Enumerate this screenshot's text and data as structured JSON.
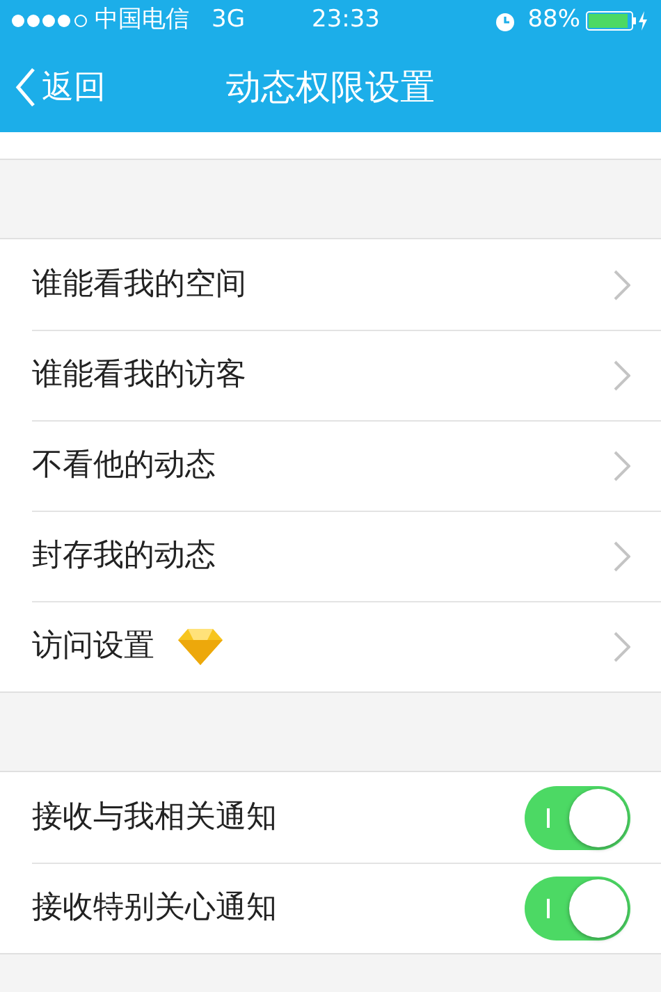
{
  "status_bar": {
    "carrier": "中国电信",
    "network": "3G",
    "time": "23:33",
    "battery": "88%"
  },
  "nav": {
    "back": "返回",
    "title": "动态权限设置"
  },
  "menu": [
    {
      "label": "谁能看我的空间",
      "premium": false
    },
    {
      "label": "谁能看我的访客",
      "premium": false
    },
    {
      "label": "不看他的动态",
      "premium": false
    },
    {
      "label": "封存我的动态",
      "premium": false
    },
    {
      "label": "访问设置",
      "premium": true
    }
  ],
  "toggles": [
    {
      "label": "接收与我相关通知",
      "on": true
    },
    {
      "label": "接收特别关心通知",
      "on": true
    }
  ]
}
